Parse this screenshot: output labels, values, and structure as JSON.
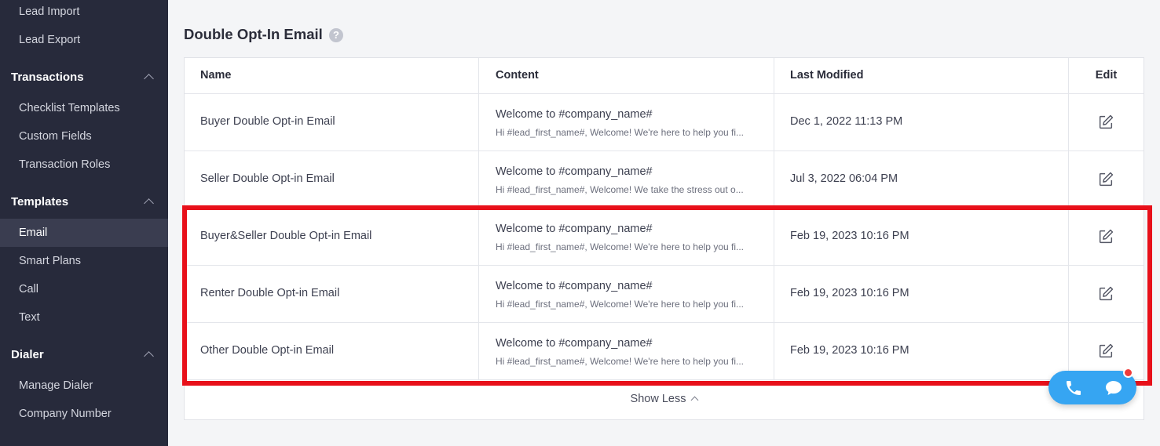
{
  "sidebar": {
    "items_top": [
      {
        "label": "Lead Import"
      },
      {
        "label": "Lead Export"
      }
    ],
    "sections": [
      {
        "title": "Transactions",
        "items": [
          {
            "label": "Checklist Templates"
          },
          {
            "label": "Custom Fields"
          },
          {
            "label": "Transaction Roles"
          }
        ]
      },
      {
        "title": "Templates",
        "items": [
          {
            "label": "Email",
            "active": true
          },
          {
            "label": "Smart Plans"
          },
          {
            "label": "Call"
          },
          {
            "label": "Text"
          }
        ]
      },
      {
        "title": "Dialer",
        "items": [
          {
            "label": "Manage Dialer"
          },
          {
            "label": "Company Number"
          }
        ]
      }
    ]
  },
  "page": {
    "title": "Double Opt-In Email",
    "help_icon": "?"
  },
  "table": {
    "columns": [
      "Name",
      "Content",
      "Last Modified",
      "Edit"
    ],
    "rows": [
      {
        "name": "Buyer Double Opt-in Email",
        "subject": "Welcome to #company_name#",
        "preview": "Hi #lead_first_name#, Welcome! We're here to help you fi...",
        "modified": "Dec 1, 2022 11:13 PM"
      },
      {
        "name": "Seller Double Opt-in Email",
        "subject": "Welcome to #company_name#",
        "preview": "Hi #lead_first_name#, Welcome! We take the stress out o...",
        "modified": "Jul 3, 2022 06:04 PM"
      },
      {
        "name": "Buyer&Seller Double Opt-in Email",
        "subject": "Welcome to #company_name#",
        "preview": "Hi #lead_first_name#, Welcome! We're here to help you fi...",
        "modified": "Feb 19, 2023 10:16 PM"
      },
      {
        "name": "Renter Double Opt-in Email",
        "subject": "Welcome to #company_name#",
        "preview": "Hi #lead_first_name#, Welcome! We're here to help you fi...",
        "modified": "Feb 19, 2023 10:16 PM"
      },
      {
        "name": "Other Double Opt-in Email",
        "subject": "Welcome to #company_name#",
        "preview": "Hi #lead_first_name#, Welcome! We're here to help you fi...",
        "modified": "Feb 19, 2023 10:16 PM"
      }
    ],
    "show_less_label": "Show Less"
  },
  "icons": {
    "edit": "edit-icon",
    "help": "question-circle-icon",
    "phone": "phone-icon",
    "chat": "chat-icon",
    "collapse": "chevron-up-icon"
  },
  "colors": {
    "sidebar_bg": "#272a3b",
    "highlight": "#e8101a",
    "widget": "#36a5f2",
    "notification": "#ef3b3b"
  }
}
